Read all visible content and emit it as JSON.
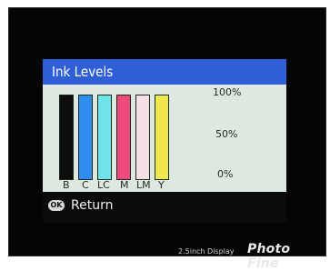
{
  "screen": {
    "title": "Ink Levels",
    "inks": [
      {
        "label": "B",
        "color": "#0d0d0d",
        "level_pct": 100
      },
      {
        "label": "C",
        "color": "#2f8cf0",
        "level_pct": 100
      },
      {
        "label": "LC",
        "color": "#6fe3e8",
        "level_pct": 100
      },
      {
        "label": "M",
        "color": "#ef4b7c",
        "level_pct": 100
      },
      {
        "label": "LM",
        "color": "#f7dfe8",
        "level_pct": 100
      },
      {
        "label": "Y",
        "color": "#f0e64e",
        "level_pct": 100
      }
    ],
    "scale": {
      "top": "100%",
      "mid": "50%",
      "bottom": "0%"
    },
    "footer": {
      "ok_badge": "OK",
      "action_label": "Return"
    }
  },
  "device_branding": {
    "display_size": "2.5inch Display",
    "brand": "Photo Fine"
  },
  "colors": {
    "title_bar": "#2f5fd6",
    "panel_bg": "#dde8e0",
    "text_dark": "#1d2c22"
  }
}
